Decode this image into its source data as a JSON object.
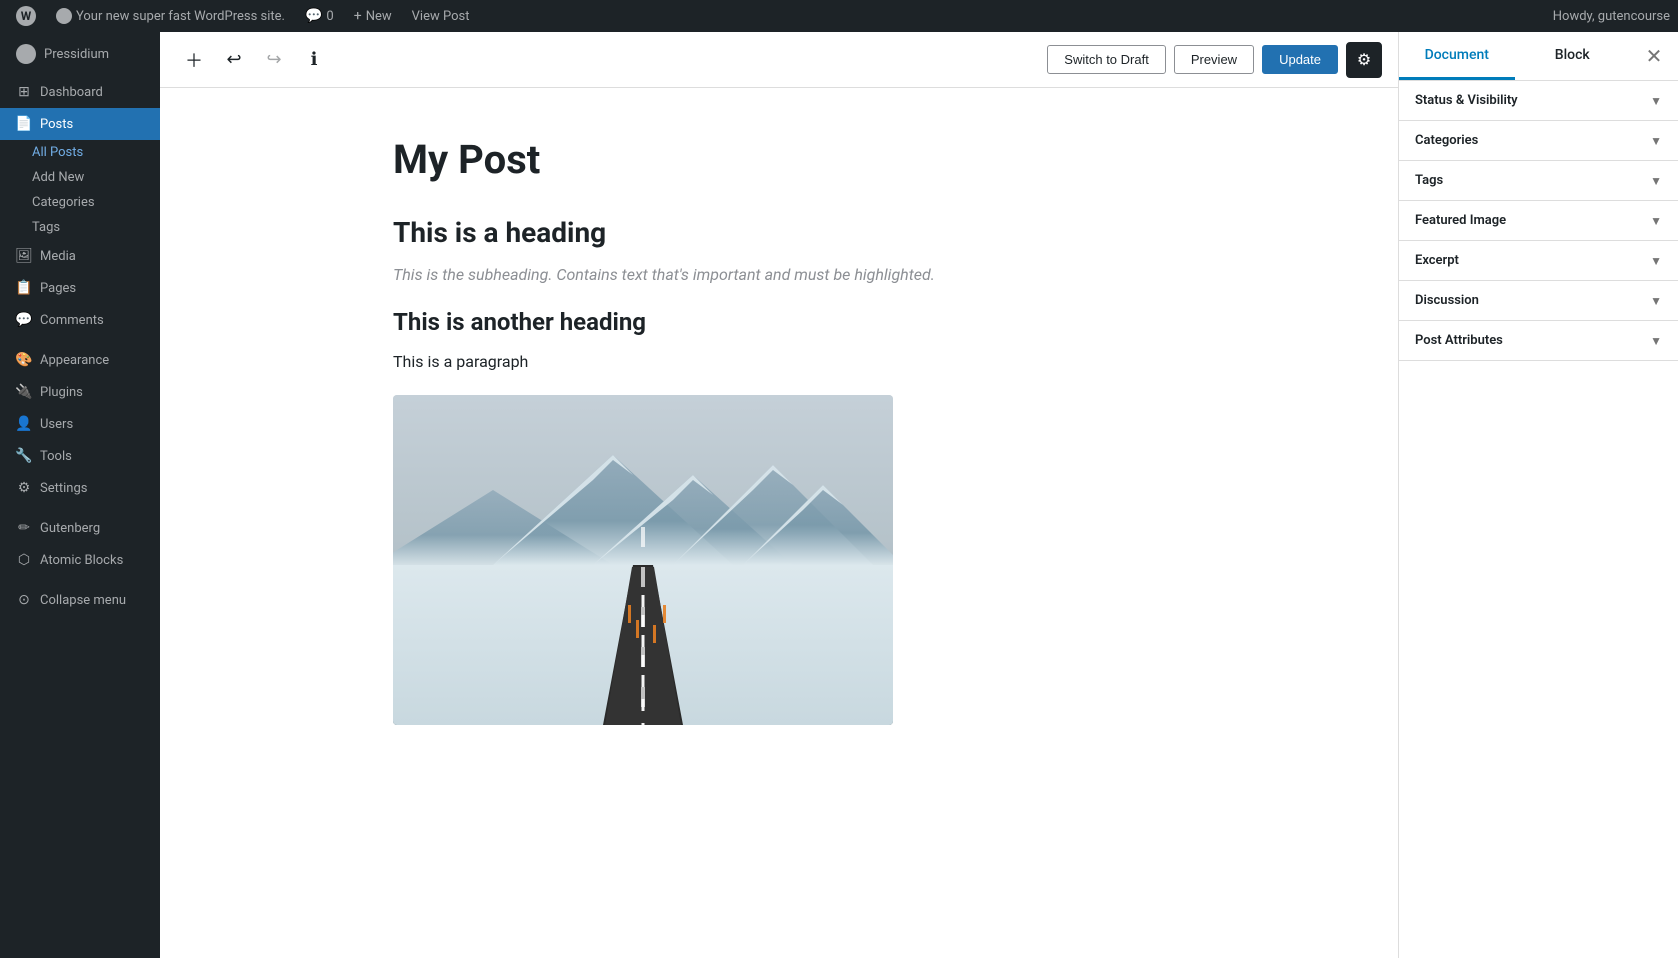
{
  "adminBar": {
    "wpLogo": "W",
    "siteName": "Your new super fast WordPress site.",
    "commentsLabel": "0",
    "newLabel": "New",
    "viewPost": "View Post",
    "howdy": "Howdy, gutencourse"
  },
  "sidebar": {
    "brandName": "Pressidium",
    "items": [
      {
        "id": "dashboard",
        "label": "Dashboard",
        "icon": "⊞"
      },
      {
        "id": "posts",
        "label": "Posts",
        "icon": "📄",
        "active": true
      },
      {
        "id": "media",
        "label": "Media",
        "icon": "🖼"
      },
      {
        "id": "pages",
        "label": "Pages",
        "icon": "📋"
      },
      {
        "id": "comments",
        "label": "Comments",
        "icon": "💬"
      },
      {
        "id": "appearance",
        "label": "Appearance",
        "icon": "🎨"
      },
      {
        "id": "plugins",
        "label": "Plugins",
        "icon": "🔌"
      },
      {
        "id": "users",
        "label": "Users",
        "icon": "👤"
      },
      {
        "id": "tools",
        "label": "Tools",
        "icon": "🔧"
      },
      {
        "id": "settings",
        "label": "Settings",
        "icon": "⚙"
      },
      {
        "id": "gutenberg",
        "label": "Gutenberg",
        "icon": "✏"
      },
      {
        "id": "atomic-blocks",
        "label": "Atomic Blocks",
        "icon": "⬡"
      }
    ],
    "postsSubItems": [
      {
        "id": "all-posts",
        "label": "All Posts",
        "active": true
      },
      {
        "id": "add-new",
        "label": "Add New"
      },
      {
        "id": "categories",
        "label": "Categories"
      },
      {
        "id": "tags",
        "label": "Tags"
      }
    ],
    "collapseLabel": "Collapse menu"
  },
  "toolbar": {
    "addBlockLabel": "+",
    "undoLabel": "↩",
    "redoLabel": "↪",
    "infoLabel": "ℹ",
    "switchDraftLabel": "Switch to Draft",
    "previewLabel": "Preview",
    "updateLabel": "Update",
    "settingsLabel": "⚙"
  },
  "editor": {
    "postTitle": "My Post",
    "heading1": "This is a heading",
    "subheading": "This is the subheading. Contains text that's important and must be highlighted.",
    "heading2": "This is another heading",
    "paragraph": "This is a paragraph"
  },
  "rightPanel": {
    "documentTabLabel": "Document",
    "blockTabLabel": "Block",
    "sections": [
      {
        "id": "status-visibility",
        "label": "Status & Visibility"
      },
      {
        "id": "categories",
        "label": "Categories"
      },
      {
        "id": "tags",
        "label": "Tags"
      },
      {
        "id": "featured-image",
        "label": "Featured Image"
      },
      {
        "id": "excerpt",
        "label": "Excerpt"
      },
      {
        "id": "discussion",
        "label": "Discussion"
      },
      {
        "id": "post-attributes",
        "label": "Post Attributes"
      }
    ]
  }
}
